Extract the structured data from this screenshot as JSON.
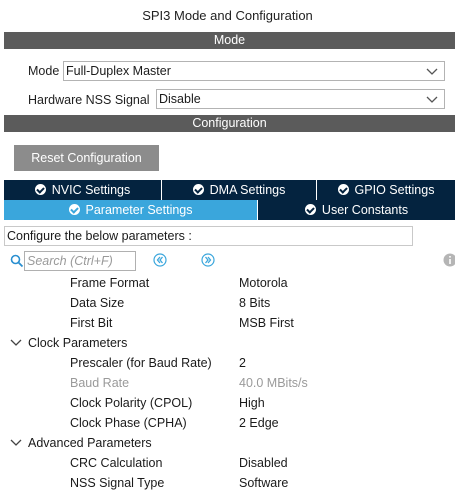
{
  "window": {
    "title": "SPI3 Mode and Configuration"
  },
  "mode_section": {
    "header": "Mode",
    "mode_label": "Mode",
    "mode_value": "Full-Duplex Master",
    "nss_label": "Hardware NSS Signal",
    "nss_value": "Disable"
  },
  "config_section": {
    "header": "Configuration",
    "reset_button": "Reset Configuration",
    "tabs_row1": [
      "NVIC Settings",
      "DMA Settings",
      "GPIO Settings"
    ],
    "tabs_row2": [
      "Parameter Settings",
      "User Constants"
    ],
    "active_tab": "Parameter Settings"
  },
  "parameters": {
    "hint": "Configure the below parameters :",
    "search_placeholder": "Search (Ctrl+F)",
    "rows": [
      {
        "name": "Frame Format",
        "value": "Motorola"
      },
      {
        "name": "Data Size",
        "value": "8 Bits"
      },
      {
        "name": "First Bit",
        "value": "MSB First"
      }
    ],
    "clock_group": "Clock Parameters",
    "clock_rows": [
      {
        "name": "Prescaler (for Baud Rate)",
        "value": "2"
      },
      {
        "name": "Baud Rate",
        "value": "40.0 MBits/s"
      },
      {
        "name": "Clock Polarity (CPOL)",
        "value": "High"
      },
      {
        "name": "Clock Phase (CPHA)",
        "value": "2 Edge"
      }
    ],
    "advanced_group": "Advanced Parameters",
    "advanced_rows": [
      {
        "name": "CRC Calculation",
        "value": "Disabled"
      },
      {
        "name": "NSS Signal Type",
        "value": "Software"
      }
    ]
  },
  "colors": {
    "section_bar": "#5b5b5b",
    "tab_dark": "#04233f",
    "tab_active": "#3aa6dc",
    "reset_button": "#8c8c8c",
    "nav_icon": "#3aa6dc"
  },
  "icons": [
    "chevron-down-icon",
    "check-circle-icon",
    "search-icon",
    "nav-left-icon",
    "nav-right-icon",
    "info-icon",
    "expand-chevron-icon"
  ]
}
